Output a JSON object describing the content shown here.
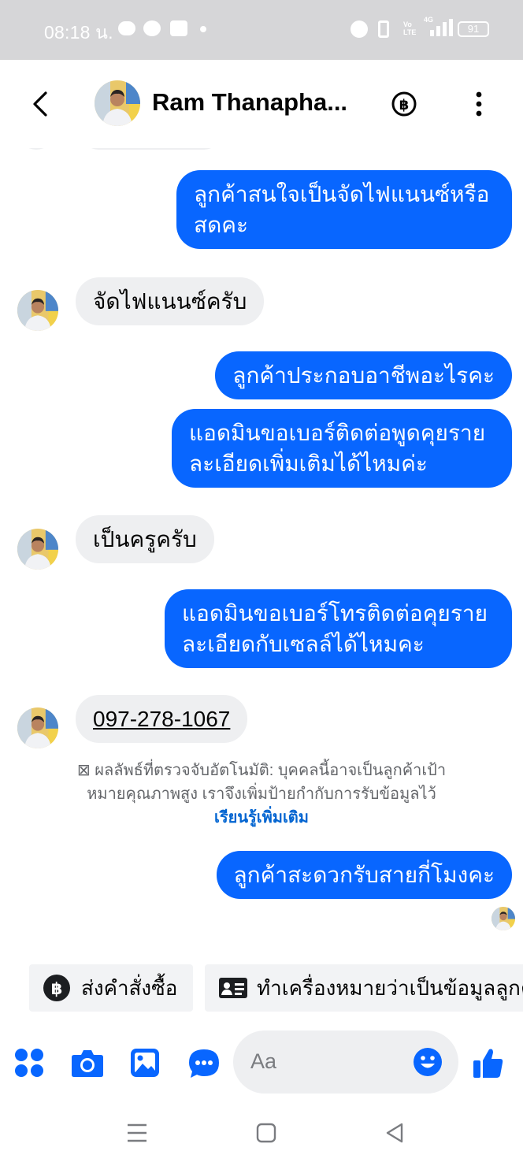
{
  "status_bar": {
    "time": "08:18 น.",
    "icons": [
      "line-icon",
      "messenger-icon",
      "gmail-icon",
      "dot-icon",
      "alarm-icon",
      "vibrate-icon",
      "volte-icon",
      "signal-4g-icon",
      "battery-icon"
    ],
    "volte": "Vo LTE",
    "network": "4G",
    "battery": "91"
  },
  "header": {
    "contact_name": "Ram Thanapha...",
    "icons": [
      "back-chevron-icon",
      "baht-icon",
      "more-vertical-icon"
    ]
  },
  "messages": [
    {
      "side": "out",
      "text": "ลูกค้าสนใจเป็นจัดไฟแนนซ์หรือสดคะ"
    },
    {
      "side": "in",
      "text": "จัดไฟแนนซ์ครับ"
    },
    {
      "side": "out",
      "text": "ลูกค้าประกอบอาชีพอะไรคะ"
    },
    {
      "side": "out",
      "text": "แอดมินขอเบอร์ติดต่อพูดคุยรายละเอียดเพิ่มเติมได้ไหมค่ะ"
    },
    {
      "side": "in",
      "text": "เป็นครูครับ"
    },
    {
      "side": "out",
      "text": "แอดมินขอเบอร์โทรติดต่อคุยรายละเอียดกับเซลล์ได้ไหมคะ"
    },
    {
      "side": "in",
      "text": "097-278-1067"
    },
    {
      "side": "out",
      "text": "ลูกค้าสะดวกรับสายกี่โมงคะ"
    }
  ],
  "notice": {
    "text": "ผลลัพธ์ที่ตรวจจับอัตโนมัติ: บุคคลนี้อาจเป็นลูกค้าเป้าหมายคุณภาพสูง เราจึงเพิ่มป้ายกำกับการรับข้อมูลไว้",
    "link": "เรียนรู้เพิ่มเติม"
  },
  "quick_actions": [
    {
      "label": "ส่งคำสั่งซื้อ",
      "icon": "baht-circle-icon"
    },
    {
      "label": "ทำเครื่องหมายว่าเป็นข้อมูลลูกค้า",
      "icon": "contact-card-icon"
    }
  ],
  "composer": {
    "placeholder": "Aa",
    "icons": [
      "menu-dots-icon",
      "camera-icon",
      "gallery-icon",
      "chat-bubble-icon",
      "emoji-icon",
      "like-icon"
    ]
  },
  "colors": {
    "accent": "#0866ff",
    "incoming_bubble": "#eeeff1",
    "status_bar": "#d6d6d8",
    "link": "#0064d1"
  }
}
